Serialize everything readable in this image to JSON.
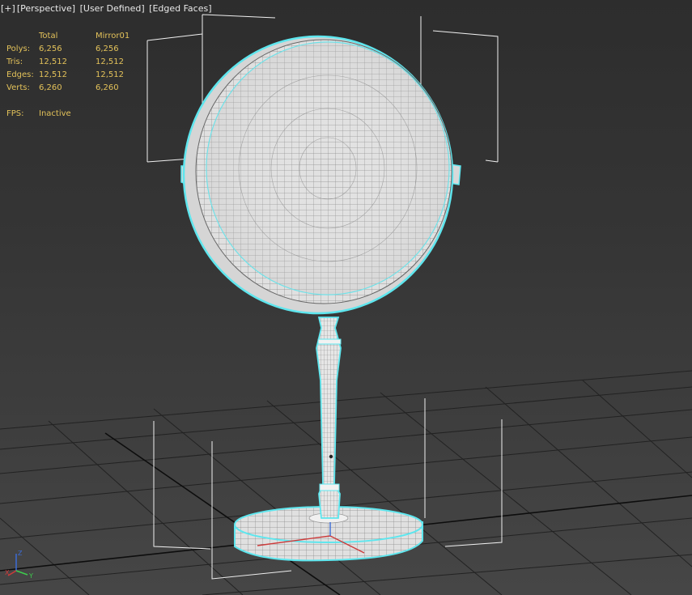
{
  "viewport": {
    "labels": {
      "plus": "[+]",
      "view": "[Perspective]",
      "mode": "[User Defined]",
      "shading": "[Edged Faces]"
    },
    "stats": {
      "col_total": "Total",
      "col_object": "Mirror01",
      "rows": [
        {
          "label": "Polys:",
          "total": "6,256",
          "object": "6,256"
        },
        {
          "label": "Tris:",
          "total": "12,512",
          "object": "12,512"
        },
        {
          "label": "Edges:",
          "total": "12,512",
          "object": "12,512"
        },
        {
          "label": "Verts:",
          "total": "6,260",
          "object": "6,260"
        }
      ],
      "fps_label": "FPS:",
      "fps_value": "Inactive"
    },
    "axis_gizmo": {
      "x": "X",
      "y": "Y",
      "z": "Z"
    },
    "object_name": "Mirror01"
  },
  "colors": {
    "background": "#353535",
    "grid_line": "#1f1f1f",
    "grid_axis": "#000000",
    "wireframe": "#ffffff",
    "mesh_fill": "#dcdcdc",
    "selection_outline": "#5ee6ee",
    "stats_text": "#e3c25a",
    "label_text": "#e8e8e8"
  }
}
